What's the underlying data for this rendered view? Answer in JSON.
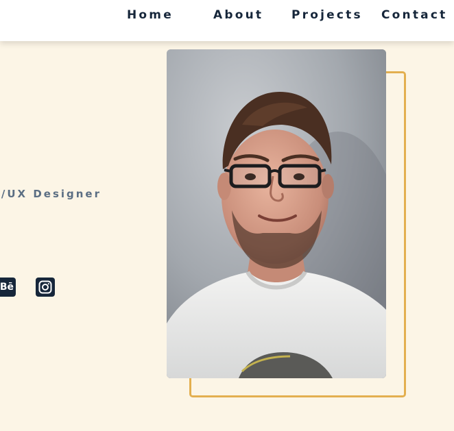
{
  "nav": {
    "home": "Home",
    "about": "About",
    "projects": "Projects",
    "contact": "Contact"
  },
  "hero": {
    "role": "UI/UX Designer"
  },
  "social": [
    {
      "name": "behance",
      "icon": "behance-icon",
      "glyph": "Bē"
    },
    {
      "name": "instagram",
      "icon": "instagram-icon"
    }
  ],
  "colors": {
    "background": "#fcf5e6",
    "nav_background": "#ffffff",
    "nav_text": "#16263a",
    "role_text": "#5b6e83",
    "accent_frame": "#e3af4f",
    "icon_bg": "#16263a"
  }
}
